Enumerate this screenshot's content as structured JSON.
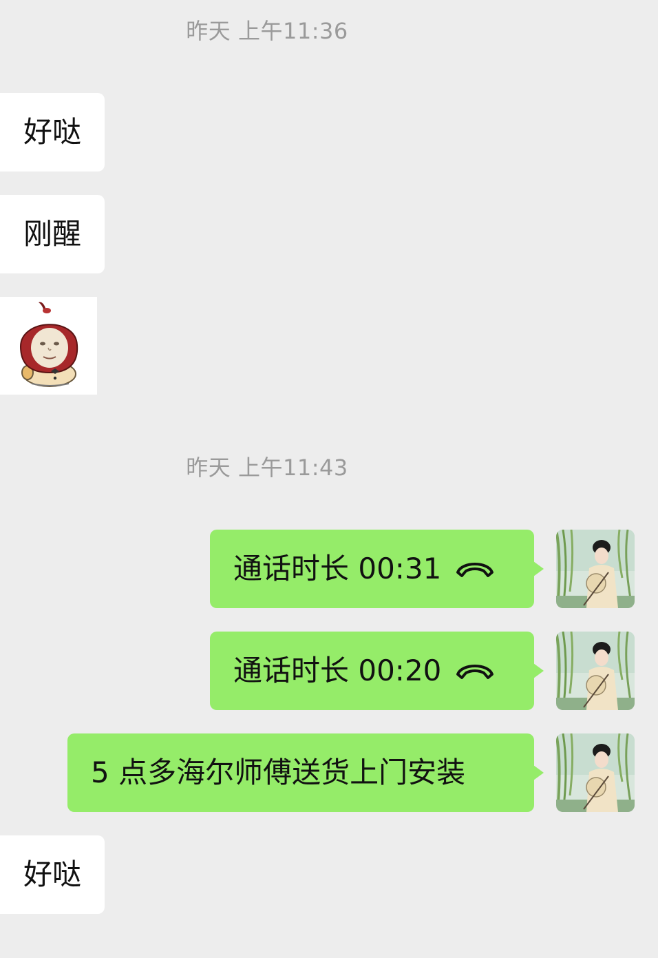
{
  "timestamps": {
    "first": "昨天 上午11:36",
    "second": "昨天 上午11:43"
  },
  "messages": {
    "m1": "好哒",
    "m2": "刚醒",
    "call1": "通话时长 00:31",
    "call2": "通话时长 00:20",
    "m5": "5 点多海尔师傅送货上门安装",
    "m6": "好哒"
  },
  "colors": {
    "background": "#ededed",
    "incoming_bubble": "#ffffff",
    "outgoing_bubble": "#95ec69",
    "timestamp_text": "#9a9a9a"
  },
  "icons": {
    "call": "phone-hangup-icon",
    "sticker": "apple-hood-meme-sticker",
    "avatar": "user-avatar-photo"
  }
}
